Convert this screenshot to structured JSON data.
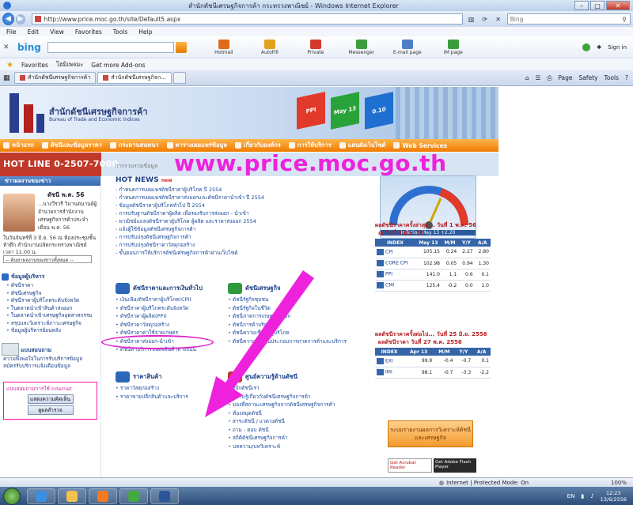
{
  "window": {
    "title": "สำนักดัชนีเศรษฐกิจการค้า กระทรวงพาณิชย์ - Windows Internet Explorer",
    "url": "http://www.price.moc.go.th/site/Default5.aspx",
    "search_placeholder": "Bing"
  },
  "menu": [
    "File",
    "Edit",
    "View",
    "Favorites",
    "Tools",
    "Help"
  ],
  "bing": {
    "logo": "bing",
    "items": [
      {
        "label": "Hotmail",
        "color": "#e06a1b"
      },
      {
        "label": "AutoFill",
        "color": "#e0a21b"
      },
      {
        "label": "Private",
        "color": "#d33a2c"
      },
      {
        "label": "Messenger",
        "color": "#3a9f3a"
      },
      {
        "label": "E-mail page",
        "color": "#4c7fc6"
      },
      {
        "label": "IM page",
        "color": "#3a9f3a"
      }
    ],
    "sign_in": "Sign in"
  },
  "favorites": {
    "label": "Favorites",
    "items": [
      "โฮมิเพจมะ",
      "Get more Add-ons"
    ]
  },
  "tabs": [
    "สำนักดัชนีเศรษฐกิจการค้า",
    "สำนักดัชนีเศรษฐกิจก..."
  ],
  "commands": [
    "Page",
    "Safety",
    "Tools"
  ],
  "site": {
    "logo_th": "สำนักดัชนีเศรษฐกิจการค้า",
    "logo_en": "Bureau of Trade and Economic Indices",
    "cubes": [
      {
        "label": "PPI",
        "color": "#e23a2a"
      },
      {
        "label": "May 13",
        "color": "#2aa23a"
      },
      {
        "label": "0.10",
        "color": "#1e6fd0"
      }
    ],
    "nav": [
      "หน้าแรก",
      "ดัชนีและข้อมูลราคา",
      "กระดานสนทนา",
      "ตารางเผยแพร่ข้อมูล",
      "เกี่ยวกับองค์กร",
      "การให้บริการ",
      "แผนผังเว็บไซต์",
      "Web Services"
    ],
    "hotline": "HOT LINE 0-2507-7000",
    "breadcrumb": "การรวบรวมข้อมูล",
    "big_url": "www.price.moc.go.th"
  },
  "left": {
    "news_head": "ข่าวผลงานของข่าว",
    "news_title": "ดัชนี พ.ค. 56",
    "news_text": "...นางวีรวรี วิมานตนานย์ผู้อำนวยการสำนักงานเศรษฐกิจการค้าประจำเดือน พ.ค. 56",
    "news_text2": "ในวันจันทร์ที่ 3 มิ.ย. 56 ณ ห้องประชุมชั้นห้าตึก สำนักงานปลัดกระทรวงพาณิชย์ เวลา 11.00 น.",
    "news_select": "-- ค้นหาผลงานของข่าวทั้งหมด --",
    "svc_head": "ข้อมูลผู้บริหาร",
    "svc_items": [
      "ดัชนีราคา",
      "ดัชนีเศรษฐกิจ",
      "ดัชนีราคาผู้บริโภคระดับจังหวัด",
      "ในตลาดนำเข้าสินค้าส่งออก",
      "ในตลาดนำเข้าเศรษฐกิจอุตสาหกรรม",
      "สรุปและวิเคราะห์ภาวะเศรษฐกิจ",
      "ข้อมูลผู้บริหารย้อนหลัง"
    ],
    "reply_head": "แบบสอบถาม",
    "reply_items": [
      "ความพึงพอใจในการรับบริการข้อมูล",
      "สมัครรับบริการแจ้งเตือนข้อมูล"
    ],
    "links_title": "แบบสอบถามการใช้ Internet",
    "link_buttons": [
      "แสดงความคิดเห็น",
      "ดูผลสำรวจ"
    ]
  },
  "hotnews": {
    "title": "HOT NEWS",
    "badge": "new",
    "items": [
      "กำหนดการเผยแพร่ดัชนีราคาผู้บริโภค ปี 2554",
      "กำหนดการเผยแพร่ดัชนีราคาส่งออกและดัชนีราคานำเข้า ปี 2554",
      "ข้อมูลดัชนีราคาผู้บริโภคทั่วไป ปี 2554",
      "การปรับฐานดัชนีราคาผู้ผลิต เพื่อรองรับการส่งออก - นำเข้า",
      "พาณิชย์แถลงดัชนีราคาผู้บริโภค ผู้ผลิต และราคาส่งออก 2554",
      "แจ้งผู้ใช้ข้อมูลดัชนีเศรษฐกิจการค้า",
      "การปรับปรุงดัชนีเศรษฐกิจการค้า",
      "การปรับปรุงดัชนีราคาวัสดุก่อสร้าง",
      "ขั้นตอนการให้บริการดัชนีเศรษฐกิจการค้าผ่านเว็บไซต์"
    ]
  },
  "sections": {
    "price": {
      "head": "ดัชนีราคาและการเงินทั่วไป",
      "items": [
        "เงินเฟ้อ/ดัชนีราคาผู้บริโภค(CPI)",
        "ดัชนีราคาผู้บริโภคระดับจังหวัด",
        "ดัชนีราคาผู้ผลิต(PPI)",
        "ดัชนีราคาวัสดุก่อสร้าง",
        "ดัชนีราคาค่าใช้จ่ายเกษตร",
        "ดัชนีราคาส่งออก-นำเข้า",
        "ดัชนีค่าบริการขนส่งสินค้าทางถนน"
      ]
    },
    "econ": {
      "head": "ดัชนีเศรษฐกิจ",
      "items": [
        "ดัชนีรัฐกิจชุมชน",
        "ดัชนีรัฐกิจในชีวิต",
        "ดัชนีภาคการเกษตรส่งออก",
        "ดัชนีการค้าบริการ",
        "ดัชนีความเชื่อมั่นผู้บริโภค",
        "ดัชนีความเชื่อมั่นประกอบการภาคการค้าและบริการ"
      ]
    },
    "goods": {
      "head": "ราคาสินค้า",
      "items": [
        "ราคาวัสดุก่อสร้าง",
        "ราคาขายปลีกสินค้าและบริการ"
      ]
    },
    "data": {
      "head": "ศูนย์ความรู้ด้านดัชนี",
      "items": [
        "รู้จักดัชนีเรา",
        "ความรู้เกี่ยวกับดัชนีเศรษฐกิจการค้า",
        "มองที่สถานะเศรษฐกิจจากดัชนีเศรษฐกิจการค้า",
        "ห้องสมุดดัชนี",
        "สาระดัชนี / แวดวงดัชนี",
        "ถาม - ตอบ ดัชนี",
        "สถิติดัชนีเศรษฐกิจการค้า",
        "บทความ/บทวิเคราะห์"
      ]
    }
  },
  "gauge": {
    "caption": "Inflation  May 13 +2.20"
  },
  "indices": {
    "title1": "ผลดัชนีราคาครั้งล่าสุด... วันที่ 1 พ.ค. 56",
    "sub1": "ณ วันที่ 3 มิ.ย. 56",
    "headers": [
      "INDEX",
      "May 13",
      "M/M",
      "Y/Y",
      "A/A"
    ],
    "rows": [
      [
        "CPI",
        "105.15",
        "0.24",
        "2.27",
        "2.80"
      ],
      [
        "CORE CPI",
        "102.98",
        "0.05",
        "0.94",
        "1.30"
      ],
      [
        "PPI",
        "141.0",
        "1.1",
        "0.6",
        "0.1"
      ],
      [
        "CMI",
        "125.4",
        "-0.2",
        "0.0",
        "1.0"
      ]
    ],
    "title2": "ผลดัชนีราคาครั้งต่อไป... วันที่ 25 มิ.ย. 2556",
    "sub2": "ผลดัชนีราคา วันที่ 27 พ.ค. 2556",
    "headers2": [
      "INDEX",
      "Apr 13",
      "M/M",
      "Y/Y",
      "A/A"
    ],
    "rows2": [
      [
        "EXI",
        "99.9",
        "-0.4",
        "-0.7",
        "0.1"
      ],
      [
        "IMI",
        "98.1",
        "-0.7",
        "-3.3",
        "-2.2"
      ]
    ]
  },
  "promo": {
    "orange_button": "ระบบรายงานผลการวิเคราะห์ดัชนีและเศรษฐกิจ",
    "acrobat": "Get Acrobat Reader",
    "flash": "Get Adobe Flash Player"
  },
  "status": {
    "zone": "Internet | Protected Mode: On",
    "zoom": "100%"
  },
  "taskbar": {
    "items": [
      {
        "name": "ie",
        "color": "#3b8fe0"
      },
      {
        "name": "explorer",
        "color": "#f2c14e"
      },
      {
        "name": "media",
        "color": "#f47a1f"
      },
      {
        "name": "chrome",
        "color": "#45a845"
      },
      {
        "name": "word",
        "color": "#2b579a"
      }
    ],
    "lang": "EN",
    "time": "12:23",
    "date": "13/6/2556"
  }
}
